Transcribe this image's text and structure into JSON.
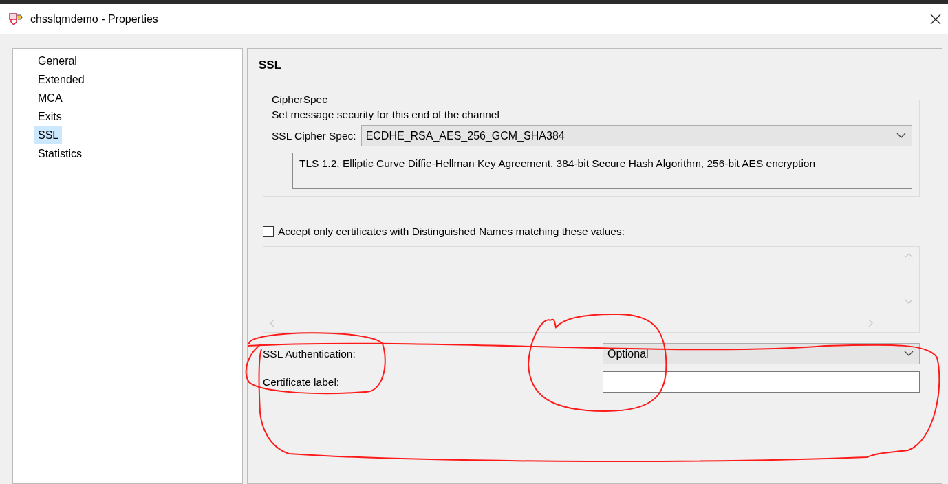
{
  "window": {
    "title": "chsslqmdemo - Properties"
  },
  "sidebar": {
    "items": [
      {
        "label": "General",
        "selected": false
      },
      {
        "label": "Extended",
        "selected": false
      },
      {
        "label": "MCA",
        "selected": false
      },
      {
        "label": "Exits",
        "selected": false
      },
      {
        "label": "SSL",
        "selected": true
      },
      {
        "label": "Statistics",
        "selected": false
      }
    ]
  },
  "panel": {
    "heading": "SSL",
    "cipher_group": {
      "legend": "CipherSpec",
      "description": "Set message security for this end of the channel",
      "cipher_label": "SSL Cipher Spec:",
      "cipher_value": "ECDHE_RSA_AES_256_GCM_SHA384",
      "cipher_details": "TLS 1.2, Elliptic Curve Diffie-Hellman Key Agreement, 384-bit Secure Hash Algorithm, 256-bit AES encryption"
    },
    "dn_filter": {
      "label": "Accept only certificates with Distinguished Names matching these values:",
      "checked": false
    },
    "ssl_authentication": {
      "label": "SSL Authentication:",
      "value": "Optional"
    },
    "certificate_label": {
      "label": "Certificate label:"
    }
  }
}
